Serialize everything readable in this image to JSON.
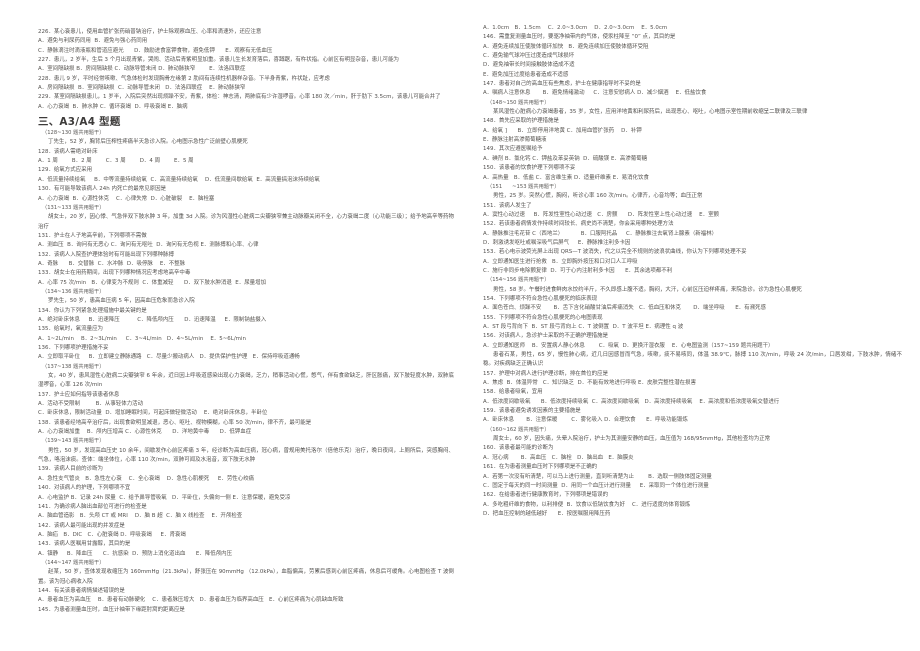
{
  "document": {
    "type": "scanned-exam-page",
    "language": "zh-CN",
    "columns": 2,
    "section_heading": "三、A3/A4 型题",
    "section_heading_sub": "（128~130 题共用题干）"
  },
  "left_column": {
    "blocks": [
      {
        "kind": "question",
        "text": "226．某心衰患儿，使用血管扩张药硝普钠治疗，护士除观察血压、心率和滴速外，还应注意"
      },
      {
        "kind": "options",
        "text": "A．避免与利尿药同用  B．避免与强心药同用"
      },
      {
        "kind": "options",
        "text": "C．静脉滴注时滴液瓶和管道应避光      D．鼓励进食富钾食物，避免低钾      E．观察有无低血压"
      },
      {
        "kind": "question",
        "text": "227．患儿，2 岁半，生后 3 个月出现青紫，哭闹、活动后青紫明显加重。该患儿生长发育落后，喜蹲踞，有杵状指。心前区有明显杂音，患儿可能为"
      },
      {
        "kind": "options",
        "text": "A．室间隔缺损 B．房间隔缺损 C．动脉导管未闭 D．肺动脉狭窄        E．法洛四联症"
      },
      {
        "kind": "question",
        "text": "228．患儿 9 岁，平时经常咳嗽、气急体检时发现胸骨左缘第 2 肋间有连续性机器样杂音。下半身青紫，杵状趾，应考虑"
      },
      {
        "kind": "options",
        "text": "A．房间隔缺损  B．室间隔缺损  C．动脉导管未闭   D．法洛四联症    E．肺动脉狭窄"
      },
      {
        "kind": "question",
        "text": "229．某室间隔缺损患儿，1 岁半，入院后突然出现烦躁不安，青紫，体检：神志清，两肺底有少许湿啰音。心率 180 次／min，肝于肋下 3.5cm，该患儿可能合并了"
      },
      {
        "kind": "options",
        "text": "A．心力衰竭  B．肺水肿 C．循环衰竭  D．呼吸衰竭 E．脑病"
      },
      {
        "kind": "section-heading",
        "text": "三、A3/A4 型题"
      },
      {
        "kind": "group",
        "text": "（128~130 题共用题干）"
      },
      {
        "kind": "stem",
        "text": "丁先生，52 岁，胸背后压榨性疼痛半天急诊入院。心电图示急性广泛前壁心肌梗死"
      },
      {
        "kind": "question",
        "text": "128．该病人需绝对卧床"
      },
      {
        "kind": "options",
        "text": "A．1 周        B．2 周        C．3 周        D．4 周        E．5 周"
      },
      {
        "kind": "question",
        "text": "129．给氧方式应采用"
      },
      {
        "kind": "options",
        "text": "A．低流量持续给氧     B．中等流量持续给氧  C．高流量持续给氧    D．低流量间歇给氧  E．高流量搞泡沫持续给氧"
      },
      {
        "kind": "question",
        "text": "130．有可能导致该病人 24h 内死亡的最常见原因是"
      },
      {
        "kind": "options",
        "text": "A．心力衰竭  B．心源性休克    C．心律失常  D．心脏破裂    E．脑栓塞"
      },
      {
        "kind": "group",
        "text": "（131~133 题共用题干）"
      },
      {
        "kind": "stem",
        "text": "胡女士，20 岁，因心悸、气急伴双下肢水肿 3 年，加重 3d 入院。诊为风湿性心脏病二尖瓣狭窄兼主动脉瓣关闭不全，心力衰竭二度（心功能三级）；给予地高辛等药物治疗"
      },
      {
        "kind": "question",
        "text": "131．护士在人子地高辛前，下列哪项不需做"
      },
      {
        "kind": "options",
        "text": "A．测血压  B．询问有无恶心 C．询问有无呕吐  D．询问有无色视 E．测脉搏和心率、心律"
      },
      {
        "kind": "question",
        "text": "132．该病人入院查护理体验时有可能出现下列哪种脉搏"
      },
      {
        "kind": "options",
        "text": "A．奇脉      B．交替脉  C．水冲脉  D．吸停脉    E．不整脉"
      },
      {
        "kind": "question",
        "text": "133．胡女士在用药期间，出现下列哪种情况应考虑地高辛中毒"
      },
      {
        "kind": "options",
        "text": "A．心率 75 次/min   B．心律变为不规则  C．体重减轻      D．双下肢水肿消退  E．尿量增加"
      },
      {
        "kind": "group",
        "text": "（134~136 题共用题干）"
      },
      {
        "kind": "stem",
        "text": "罗先生，50 岁，患高血压病 5 年，因高血压危象而急诊入院"
      },
      {
        "kind": "question",
        "text": "134．你认为下列紧急处理措施中最关键的是"
      },
      {
        "kind": "options",
        "text": "A．绝对卧床休息     B．迅速降压          C．降低颅内压      D．迅速降温     E．限制钠盐摄入"
      },
      {
        "kind": "question",
        "text": "135．给氧时，氧流量应为"
      },
      {
        "kind": "options",
        "text": "A．1~2L/min    B．2~3L/min     C．3~4L/min   D．4~5L/min    E．5~6L/min"
      },
      {
        "kind": "question",
        "text": "136．下列哪项护理措施不妥"
      },
      {
        "kind": "options",
        "text": "A．立即取平卧位     B．立即建立静脉通路   C．尽量少搬动病人   D．提供保护性护理   E．保持呼吸道通畅"
      },
      {
        "kind": "group",
        "text": "（137~138 题共用题干）"
      },
      {
        "kind": "stem",
        "text": "女，40 岁，患风湿性心脏病二尖瓣狭窄 6 年余，近日因上呼吸道感染出现心力衰竭，乏力，稍事活动心慌，憋气，伴有食欲缺乏，肝区胀痛，双下肢轻度水肿，双肺底湿啰音，心率 126 次/min"
      },
      {
        "kind": "question",
        "text": "137．护士应如何指导该患者休息"
      },
      {
        "kind": "options",
        "text": "A．活动不受限制         B．从事轻体力活动"
      },
      {
        "kind": "options",
        "text": "C．卧床休息，限制活动量  D．增加睡眠时间，可起床做轻微活动    E．绝对卧床休息，半卧位"
      },
      {
        "kind": "question",
        "text": "138．该患者经地高辛治疗后，出现食欲明显减退，恶心、呕吐、视物模糊，心率 50 次/min，律不齐，最可能是"
      },
      {
        "kind": "options",
        "text": "A．心力衰竭加重    B．颅内压增高 C．心源性休克      D．洋地黄中毒      D．低钾血症"
      },
      {
        "kind": "group",
        "text": "（139~143 题共用题干）"
      },
      {
        "kind": "stem",
        "text": "男性，50 岁，发现高血压史 10 余年，间歇发作心前区疼痛 3 年，经诊断为高血压病，冠心病，曾规用美托洛尔（倍他乐克）治疗，晚日夜间，上厕所后，突感胸闷、气急，咯泡沫痰。查体：端坐体位，心率 110 次/min，双肺可闻及水泡音，双下肢无水肿"
      },
      {
        "kind": "question",
        "text": "139．该病人目前的诊断为"
      },
      {
        "kind": "options",
        "text": "A．急性支气管炎   B．急性左心衰    C．全心衰竭    D．急性心肌梗死     E．劳性心绞痛"
      },
      {
        "kind": "question",
        "text": "140．对该病人的护理，下列哪项不宜"
      },
      {
        "kind": "options",
        "text": "A．心电监护 B．记录 24h 尿量  C．给予鼻导管吸氧   D．平卧位，头偏向一侧 E．注意保暖，避免受凉"
      },
      {
        "kind": "question",
        "text": "141．为确诊病人脑出血部位可进行的检查是"
      },
      {
        "kind": "options",
        "text": "A．脑血管造影   B．头颅 CT 或 MRI    D．脑 B 超  C．脑 X 线检查    E．开颅检查"
      },
      {
        "kind": "question",
        "text": "142．该病人最可能出现的并发症是"
      },
      {
        "kind": "options",
        "text": "A．脑疝   B．DIC   C．心脏衰竭 D．呼吸衰竭     E．肾衰竭"
      },
      {
        "kind": "question",
        "text": "143．该病人医嘱用甘露醇，其目的是"
      },
      {
        "kind": "options",
        "text": "A．镇静     B．降血压      C．抗感染  D．预防上消化道出血      E．降低颅内压"
      },
      {
        "kind": "group",
        "text": "（144~147 题共用题干）"
      },
      {
        "kind": "stem",
        "text": "赵某，50 岁，查体发现收缩压为 160mmHg（21.3kPa），舒张压在 90mmHg （12.0kPa），血脂偏高，劳累后感到心前区疼痛，休息后可缓角。心电图检查 T 波倒置。该为冠心病收入院"
      },
      {
        "kind": "question",
        "text": "144．有关该患者病情描述错误的是"
      },
      {
        "kind": "options",
        "text": "A．患者血压为高血压    B．患者有动脉硬化    C．患者脉压增大   D．患者血压为临界高血压   E．心前区疼痛为心肌缺血所致"
      },
      {
        "kind": "question",
        "text": "145．为患者测量血压时，血压计袖带下缘距肘窝的距离应是"
      }
    ]
  },
  "right_column": {
    "blocks": [
      {
        "kind": "options",
        "text": "A．1.0cm   B．1.5cm    C．2.0~3.0cm    D．2.0~3.0cm    E．5.0cm"
      },
      {
        "kind": "question",
        "text": "146．需重复测量血压时，要驱净袖带内的气体，使汞柱降至 “0” 点，其目的是"
      },
      {
        "kind": "options",
        "text": "A．避免连续加压使肢体循环加快   B．避免连续加压使肢体循环受阻"
      },
      {
        "kind": "options",
        "text": "C．避免输气球冲压过度造成气球损坏"
      },
      {
        "kind": "options",
        "text": "D．避免袖带长时间接触肢体造成不适"
      },
      {
        "kind": "options",
        "text": "E．避免加压过度给患者造成不适感"
      },
      {
        "kind": "question",
        "text": "147．患者对自己的高血压有些焦虑，护士在健康指导时不妥的是"
      },
      {
        "kind": "options",
        "text": "A．嘱病人注意休息       B．避免情绪激动     C．注意安慰病人 D．减少烟酒    E．低盐饮食"
      },
      {
        "kind": "group",
        "text": "（148~150 题共用题干）"
      },
      {
        "kind": "stem",
        "text": "某风湿性心脏病心力衰竭患者，35 岁，女性，应用洋地黄和利尿药后，出现恶心、呕吐，心电图示室性期前收缩呈二联律及三联律"
      },
      {
        "kind": "question",
        "text": "148．首先应采取的护理措施是"
      },
      {
        "kind": "options",
        "text": "A．给氧 ]      B．立即停用洋地黄 C．加用血管扩张药    D．补钾"
      },
      {
        "kind": "options",
        "text": "E．静脉注射高渗葡萄糖液"
      },
      {
        "kind": "question",
        "text": "149．其次应遵医嘱给予"
      },
      {
        "kind": "options",
        "text": "A．碘剂 B．氯化钙 C．钾盐及苯妥英钠  D．硫酸镁 E．高渗葡萄糖"
      },
      {
        "kind": "question",
        "text": "150．该患者的饮食护理下列哪项不妥"
      },
      {
        "kind": "options",
        "text": "A．高热量   B．低盐 C．富含维生素 D．适量纤维素 E．易消化饮食"
      },
      {
        "kind": "group",
        "text": "（151      ~153 题共用题干）"
      },
      {
        "kind": "stem",
        "text": "男性，25 岁。突然心慌，胸闷，听诊心率 160 次/min。心律齐，心音均等；血压正常"
      },
      {
        "kind": "question",
        "text": "151．该病人发生了"
      },
      {
        "kind": "options",
        "text": "A．窦性心动过速     B．阵发性室性心动过速   C．房颤      D．阵发性室上性心动过速    E．室颤"
      },
      {
        "kind": "question",
        "text": "152．若该患者病情发作持续时间较长、病史尚不清楚，你会采用哪种处理方法"
      },
      {
        "kind": "options",
        "text": "A．静脉推注毛花苷 C（西地兰）          B．口服阿托品     C．静脉推注去氧肾上腺素（新福林）"
      },
      {
        "kind": "options",
        "text": "D．刺激诱发呕吐或嘱深吸气后屏气     E．静脉推注利多卡因"
      },
      {
        "kind": "question",
        "text": "153．若心电示波荧光屏上出现 QRS—T 波消失，代之以完全不规则的波浪状曲线，你认为下列哪项处理不妥"
      },
      {
        "kind": "options",
        "text": "A．立即通知医生进行抢救   B．立即胸外按压和口对口人工呼吸"
      },
      {
        "kind": "options",
        "text": "C．施行非同步电除颤复律  D．可于心内注射利多卡因      E．其余选项都不利"
      },
      {
        "kind": "group",
        "text": "（154~156 题共用题干）"
      },
      {
        "kind": "stem",
        "text": "男性，58 岁。午餐时进食鲜肉水饺约半斤，不久即感上腹不适。胸闷，大汗，心前区压迫样疼痛，来院急诊。诊为急性心肌梗死"
      },
      {
        "kind": "question",
        "text": "154．下列哪项不符合急性心肌梗死的临床表现"
      },
      {
        "kind": "options",
        "text": "A．面色苍白、烦躁不安       B．舌下含化硝酸甘油后疼痛消失   C．低血压和休克       D．端坐呼吸      E．有濒死感"
      },
      {
        "kind": "question",
        "text": "155．下列哪项不符合急性心肌梗死的心电图表现"
      },
      {
        "kind": "options",
        "text": "A．ST 段弓背向下  B．ST 段弓背向上 C．T 波倒置  D．T 波平坦 E．病理性 q 波"
      },
      {
        "kind": "question",
        "text": "156．对该病人，急诊护士采取的不正确护理措施是"
      },
      {
        "kind": "options",
        "text": "A．立即通知医师    B．安置病人静心休息        C．吸氧  D．更换汗湿衣服    E．心电图监测（157~159 题共用题干）"
      },
      {
        "kind": "stem",
        "text": "患者石某，男性，65 岁，慢性肺心病，近几日因感冒而气急，咳嗽，痰不易咳同，体温 38.9℃，脉搏 110 次/min，呼吸 24 次/min，口唇发绀，下肢水肿，情绪不稳。对疾病缺乏正确认识"
      },
      {
        "kind": "question",
        "text": "157．护理中对病人进行护理诊断，排在首位的应是"
      },
      {
        "kind": "options",
        "text": "A．焦虑  B．体温异常   C．知识缺乏  D．不能有效地进行呼吸 E．皮肤完整性潜在损害"
      },
      {
        "kind": "question",
        "text": "158．给患者吸氧，宜用"
      },
      {
        "kind": "options",
        "text": "A．低浓度间歇吸氧      B．低浓度持续吸氧  C．高浓度间歇吸氧   D．高浓度持续吸氧    E．高浓度和低浓度吸氧交替进行"
      },
      {
        "kind": "question",
        "text": "159．该患者避免诱发因素的主要措施是"
      },
      {
        "kind": "options",
        "text": "A．卧床休息       B．注意保暖        C．雾化吸入 D．合理饮食      E．呼吸功能锻炼"
      },
      {
        "kind": "group",
        "text": "（160~162 题共用题干）"
      },
      {
        "kind": "stem",
        "text": "周女士，60 岁，因头痛，头晕入院治疗，护士为其测量安静的血压，血压值为 168/95mmHg，其他检查均为正常"
      },
      {
        "kind": "question",
        "text": "160．该患者最可能的诊断为"
      },
      {
        "kind": "options",
        "text": "A．冠心病       B．高血压   C．脑栓   D．脑出血   E．脑膜炎"
      },
      {
        "kind": "question",
        "text": "161．在为患者测量血压时下列哪项是不正确的"
      },
      {
        "kind": "options",
        "text": "A．若第一次没有听清楚，可以马上进行测量，直到听清楚为止        B．选取一侧肢体固定测量"
      },
      {
        "kind": "options",
        "text": "C．固定于每天的同一时间测量  D．用同一个血压计进行测量     E．采取同一个体位进行测量"
      },
      {
        "kind": "question",
        "text": "162．在给患者进行健康教育时，下列哪项是错误的"
      },
      {
        "kind": "options",
        "text": "A．多吃粗纤维的食物，以利排便  B．饮食以低钠饮食为好    C．进行适度的体育锻炼"
      },
      {
        "kind": "options",
        "text": "D．把血压控制的越低越好      E．按医嘱服用降压药"
      }
    ]
  }
}
